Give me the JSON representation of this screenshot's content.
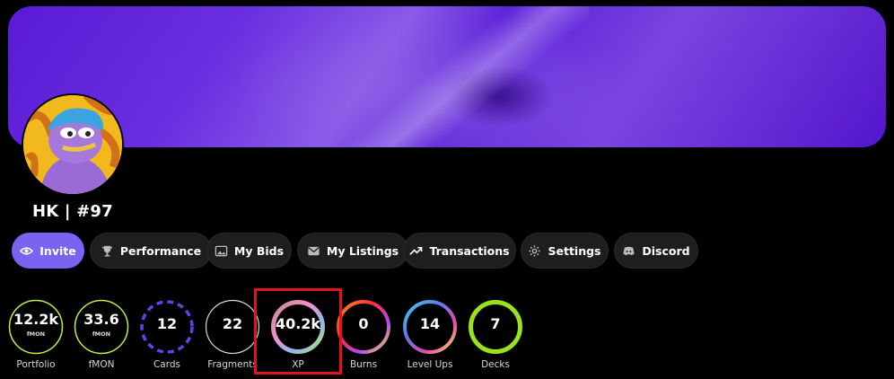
{
  "profile": {
    "username": "HK | #97"
  },
  "actions": {
    "invite": "Invite",
    "performance": "Performance",
    "my_bids": "My Bids",
    "my_listings": "My Listings",
    "transactions": "Transactions",
    "settings": "Settings",
    "discord": "Discord"
  },
  "stats": {
    "portfolio": {
      "value": "12.2k",
      "unit": "fMON",
      "label": "Portfolio"
    },
    "fmon": {
      "value": "33.6",
      "unit": "fMON",
      "label": "fMON"
    },
    "cards": {
      "value": "12",
      "label": "Cards"
    },
    "fragments": {
      "value": "22",
      "label": "Fragments"
    },
    "xp": {
      "value": "40.2k",
      "label": "XP"
    },
    "burns": {
      "value": "0",
      "label": "Burns"
    },
    "level_ups": {
      "value": "14",
      "label": "Level Ups"
    },
    "decks": {
      "value": "7",
      "label": "Decks"
    }
  },
  "colors": {
    "accent": "#7b63f2",
    "banner": "#5a1ad6",
    "highlight": "#e3131b",
    "portfolio_ring": "#b9f24a",
    "cards_ring": "#5a46e8",
    "decks_ring": "#9be21a"
  }
}
